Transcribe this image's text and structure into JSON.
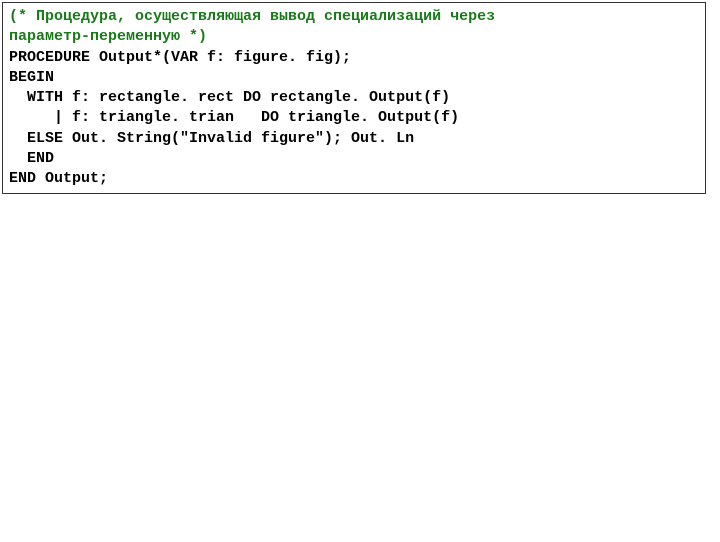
{
  "code": {
    "comment_l1": "(* Процедура, осуществляющая вывод специализаций через",
    "comment_l2": "параметр-переменную *)",
    "line3": "PROCEDURE Output*(VAR f: figure. fig);",
    "line4": "BEGIN",
    "line5": "  WITH f: rectangle. rect DO rectangle. Output(f)",
    "line6": "     | f: triangle. trian   DO triangle. Output(f)",
    "line7": "  ELSE Out. String(\"Invalid figure\"); Out. Ln",
    "line8": "  END",
    "line9": "END Output;"
  }
}
